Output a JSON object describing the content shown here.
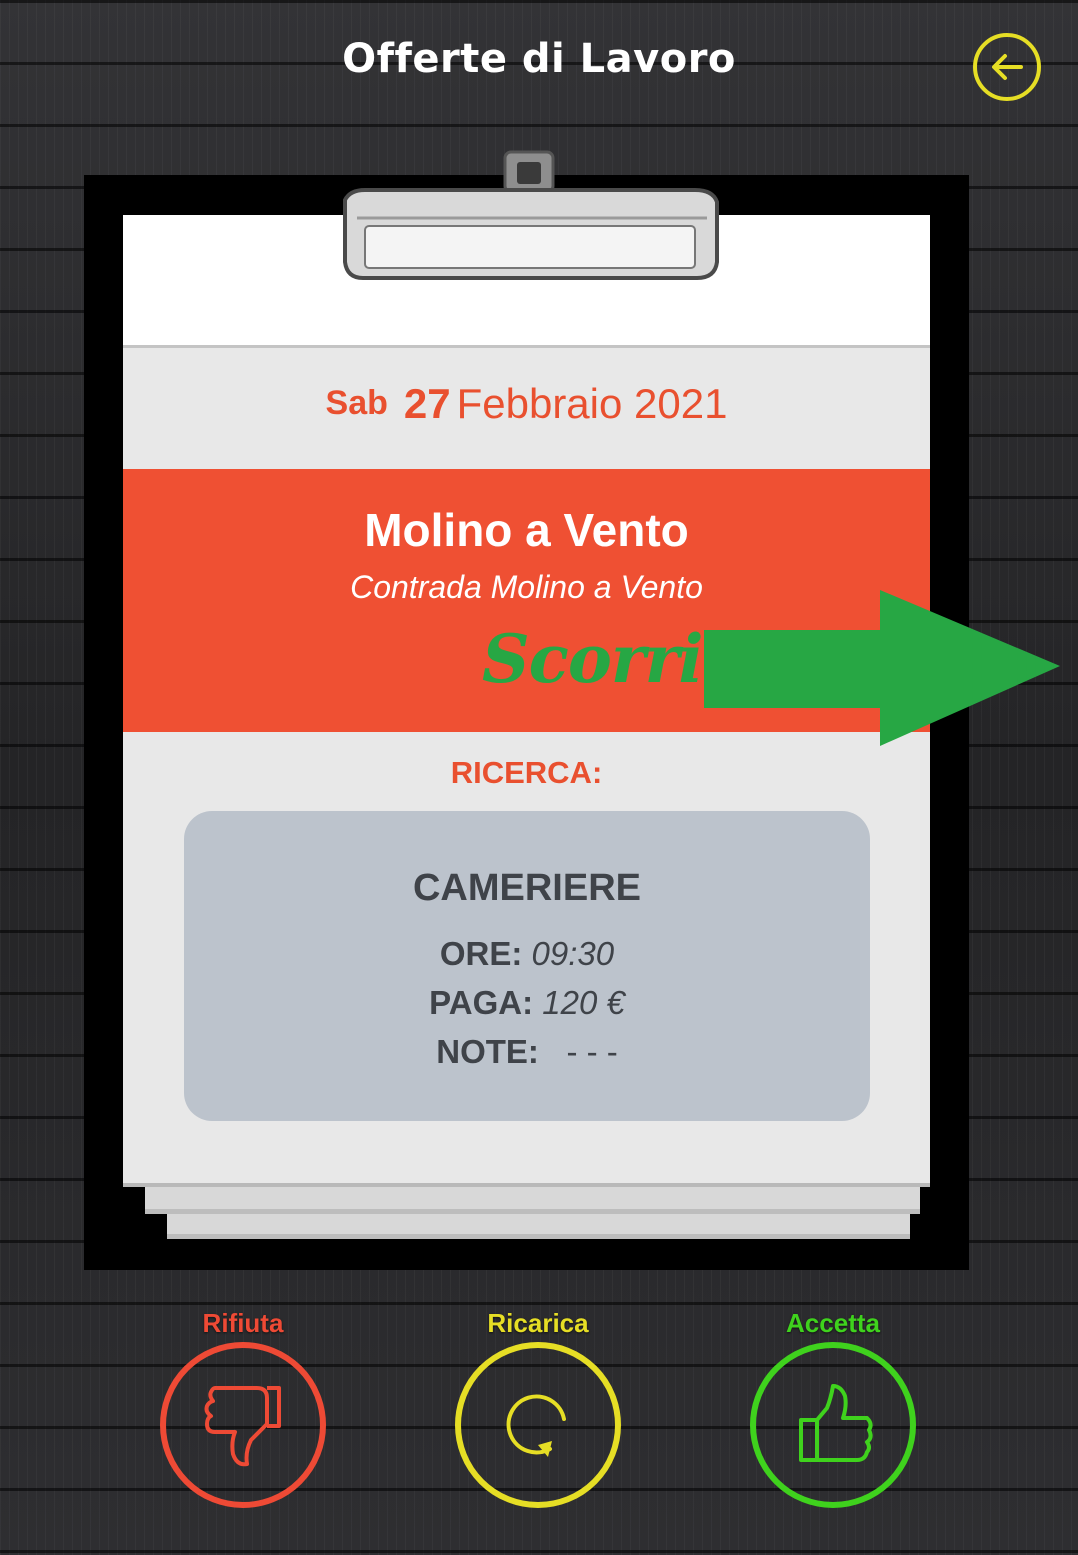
{
  "header": {
    "title": "Offerte di Lavoro",
    "back_icon": "arrow-left-circle-icon",
    "back_color": "#e6de25"
  },
  "offer": {
    "date": {
      "weekday": "Sab",
      "day": "27",
      "month_year": "Febbraio 2021"
    },
    "venue_name": "Molino a Vento",
    "venue_address": "Contrada Molino a Vento",
    "swipe_hint": "Scorri",
    "search_label": "RICERCA:",
    "job": {
      "role": "CAMERIERE",
      "hours_label": "ORE:",
      "hours_value": "09:30",
      "pay_label": "PAGA:",
      "pay_value": "120 €",
      "notes_label": "NOTE:",
      "notes_value": "- - -"
    }
  },
  "actions": {
    "reject": {
      "label": "Rifiuta",
      "icon": "thumbs-down-icon",
      "color": "#ee4a35"
    },
    "reload": {
      "label": "Ricarica",
      "icon": "refresh-icon",
      "color": "#e6de25"
    },
    "accept": {
      "label": "Accetta",
      "icon": "thumbs-up-icon",
      "color": "#3fd21d"
    }
  },
  "colors": {
    "accent_red": "#ef5033",
    "card_grey": "#bcc3cc",
    "arrow_green": "#27a744"
  }
}
